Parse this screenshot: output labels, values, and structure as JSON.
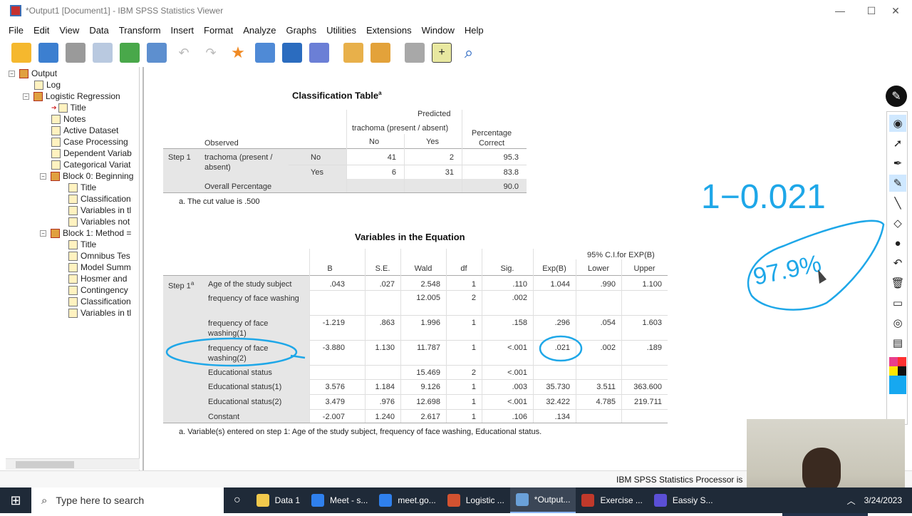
{
  "window": {
    "title": "*Output1 [Document1] - IBM SPSS Statistics Viewer",
    "controls": {
      "minimize": "—",
      "maximize": "☐",
      "close": "✕"
    }
  },
  "menu": [
    "File",
    "Edit",
    "View",
    "Data",
    "Transform",
    "Insert",
    "Format",
    "Analyze",
    "Graphs",
    "Utilities",
    "Extensions",
    "Window",
    "Help"
  ],
  "toolbar_icons": [
    "open-folder-icon",
    "save-icon",
    "print-icon",
    "print-preview-icon",
    "export-icon",
    "recall-dialog-icon",
    "undo-icon",
    "redo-icon",
    "goto-data-icon",
    "goto-case-icon",
    "insert-cases-icon",
    "insert-variable-icon",
    "split-file-icon",
    "insert-heading-icon",
    "insert-output-icon",
    "designate-window-icon",
    "promote-icon",
    "search-icon"
  ],
  "outline": [
    {
      "label": "Output",
      "indent": 0,
      "type": "root",
      "expander": "−"
    },
    {
      "label": "Log",
      "indent": 1,
      "type": "book"
    },
    {
      "label": "Logistic Regression",
      "indent": 1,
      "type": "root",
      "expander": "−"
    },
    {
      "label": "Title",
      "indent": 2,
      "type": "book",
      "arrow": true
    },
    {
      "label": "Notes",
      "indent": 2,
      "type": "book"
    },
    {
      "label": "Active Dataset",
      "indent": 2,
      "type": "book"
    },
    {
      "label": "Case Processing",
      "indent": 2,
      "type": "book"
    },
    {
      "label": "Dependent Variab",
      "indent": 2,
      "type": "book"
    },
    {
      "label": "Categorical Variat",
      "indent": 2,
      "type": "book"
    },
    {
      "label": "Block 0: Beginning",
      "indent": 2,
      "type": "root",
      "expander": "−"
    },
    {
      "label": "Title",
      "indent": 3,
      "type": "book"
    },
    {
      "label": "Classification",
      "indent": 3,
      "type": "book"
    },
    {
      "label": "Variables in tl",
      "indent": 3,
      "type": "book"
    },
    {
      "label": "Variables not",
      "indent": 3,
      "type": "book"
    },
    {
      "label": "Block 1: Method =",
      "indent": 2,
      "type": "root",
      "expander": "−"
    },
    {
      "label": "Title",
      "indent": 3,
      "type": "book"
    },
    {
      "label": "Omnibus Tes",
      "indent": 3,
      "type": "book"
    },
    {
      "label": "Model Summ",
      "indent": 3,
      "type": "book"
    },
    {
      "label": "Hosmer and",
      "indent": 3,
      "type": "book"
    },
    {
      "label": "Contingency",
      "indent": 3,
      "type": "book"
    },
    {
      "label": "Classification",
      "indent": 3,
      "type": "book"
    },
    {
      "label": "Variables in tl",
      "indent": 3,
      "type": "book"
    }
  ],
  "classification": {
    "title": "Classification Table",
    "title_sup": "a",
    "predicted": "Predicted",
    "dep_var": "trachoma (present / absent)",
    "observed": "Observed",
    "col_no": "No",
    "col_yes": "Yes",
    "pct_correct": "Percentage Correct",
    "step": "Step 1",
    "row_var": "trachoma (present / absent)",
    "rows": [
      {
        "label": "No",
        "no": "41",
        "yes": "2",
        "pct": "95.3"
      },
      {
        "label": "Yes",
        "no": "6",
        "yes": "31",
        "pct": "83.8"
      }
    ],
    "overall_label": "Overall Percentage",
    "overall_pct": "90.0",
    "footnote": "a. The cut value is .500"
  },
  "equation": {
    "title": "Variables in the Equation",
    "ci_header": "95% C.I.for EXP(B)",
    "headers": [
      "B",
      "S.E.",
      "Wald",
      "df",
      "Sig.",
      "Exp(B)",
      "Lower",
      "Upper"
    ],
    "step": "Step 1",
    "step_sup": "a",
    "rows": [
      {
        "label": "Age of the study subject",
        "vals": [
          ".043",
          ".027",
          "2.548",
          "1",
          ".110",
          "1.044",
          ".990",
          "1.100"
        ]
      },
      {
        "label": "frequency of face washing",
        "vals": [
          "",
          "",
          "12.005",
          "2",
          ".002",
          "",
          "",
          ""
        ]
      },
      {
        "label": "frequency of face washing(1)",
        "vals": [
          "-1.219",
          ".863",
          "1.996",
          "1",
          ".158",
          ".296",
          ".054",
          "1.603"
        ]
      },
      {
        "label": "frequency of face washing(2)",
        "vals": [
          "-3.880",
          "1.130",
          "11.787",
          "1",
          "<.001",
          ".021",
          ".002",
          ".189"
        ]
      },
      {
        "label": "Educational status",
        "vals": [
          "",
          "",
          "15.469",
          "2",
          "<.001",
          "",
          "",
          ""
        ]
      },
      {
        "label": "Educational status(1)",
        "vals": [
          "3.576",
          "1.184",
          "9.126",
          "1",
          ".003",
          "35.730",
          "3.511",
          "363.600"
        ]
      },
      {
        "label": "Educational status(2)",
        "vals": [
          "3.479",
          ".976",
          "12.698",
          "1",
          "<.001",
          "32.422",
          "4.785",
          "219.711"
        ]
      },
      {
        "label": "Constant",
        "vals": [
          "-2.007",
          "1.240",
          "2.617",
          "1",
          ".106",
          ".134",
          "",
          ""
        ]
      }
    ],
    "footnote": "a. Variable(s) entered on step 1: Age of the study subject, frequency of face washing, Educational status."
  },
  "status": "IBM SPSS Statistics Processor is",
  "handwriting": {
    "line1": "1−0.021",
    "line2": "97.9%"
  },
  "taskbar": {
    "search_placeholder": "Type here to search",
    "apps": [
      {
        "label": "Data 1",
        "color": "#f2c94c"
      },
      {
        "label": "Meet - s...",
        "color": "#2f80ed"
      },
      {
        "label": "meet.go...",
        "color": "#2f80ed"
      },
      {
        "label": "Logistic ...",
        "color": "#d35230"
      },
      {
        "label": "*Output...",
        "color": "#6aa0d8",
        "active": true
      },
      {
        "label": "Exercise ...",
        "color": "#c0392b"
      },
      {
        "label": "Eassiy S...",
        "color": "#5b4fd6"
      }
    ],
    "date": "3/24/2023"
  }
}
